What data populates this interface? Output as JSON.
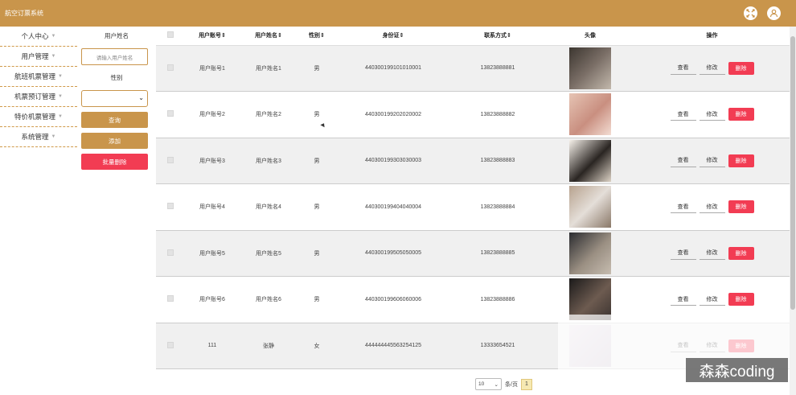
{
  "app": {
    "title": "航空订票系统"
  },
  "sidebar": {
    "items": [
      {
        "label": "个人中心"
      },
      {
        "label": "用户管理"
      },
      {
        "label": "航班机票管理"
      },
      {
        "label": "机票预订管理"
      },
      {
        "label": "特价机票管理"
      },
      {
        "label": "系统管理"
      }
    ]
  },
  "filter": {
    "username_label": "用户姓名",
    "username_placeholder": "请输入用户姓名",
    "gender_label": "性别",
    "gender_value": "",
    "query_label": "查询",
    "add_label": "添加",
    "batch_delete_label": "批量删除"
  },
  "table": {
    "headers": [
      "用户账号",
      "用户姓名",
      "性别",
      "身份证",
      "联系方式",
      "头像",
      "操作"
    ],
    "sort_mark": "⇕",
    "rows": [
      {
        "account": "用户账号1",
        "name": "用户姓名1",
        "gender": "男",
        "id_card": "440300199101010001",
        "phone": "13823888881",
        "avatar": "avatar-photo-icon"
      },
      {
        "account": "用户账号2",
        "name": "用户姓名2",
        "gender": "男",
        "id_card": "440300199202020002",
        "phone": "13823888882",
        "avatar": "avatar-photo-icon"
      },
      {
        "account": "用户账号3",
        "name": "用户姓名3",
        "gender": "男",
        "id_card": "440300199303030003",
        "phone": "13823888883",
        "avatar": "avatar-photo-icon"
      },
      {
        "account": "用户账号4",
        "name": "用户姓名4",
        "gender": "男",
        "id_card": "440300199404040004",
        "phone": "13823888884",
        "avatar": "avatar-photo-icon"
      },
      {
        "account": "用户账号5",
        "name": "用户姓名5",
        "gender": "男",
        "id_card": "440300199505050005",
        "phone": "13823888885",
        "avatar": "avatar-photo-icon"
      },
      {
        "account": "用户账号6",
        "name": "用户姓名6",
        "gender": "男",
        "id_card": "440300199606060006",
        "phone": "13823888886",
        "avatar": "avatar-photo-icon"
      },
      {
        "account": "111",
        "name": "张静",
        "gender": "女",
        "id_card": "444444445563254125",
        "phone": "13333654521",
        "avatar": "avatar-photo-icon"
      }
    ],
    "actions": {
      "view": "查看",
      "edit": "修改",
      "delete": "删除"
    }
  },
  "pagination": {
    "page_size": "10",
    "per_page_label": "条/页",
    "current_page": "1"
  },
  "watermark": {
    "text": "森森coding"
  },
  "colors": {
    "brand": "#c9954b",
    "danger": "#f23c53"
  }
}
